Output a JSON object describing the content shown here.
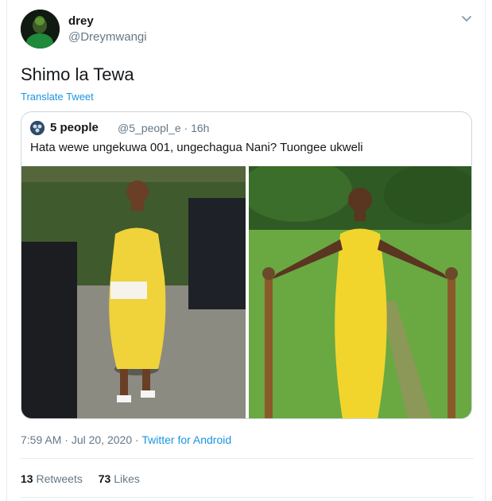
{
  "tweet": {
    "author_name": "drey",
    "author_handle": "@Dreymwangi",
    "text": "Shimo la Tewa",
    "translate_label": "Translate Tweet",
    "time": "7:59 AM",
    "date": "Jul 20, 2020",
    "source": "Twitter for Android",
    "retweets_count": "13",
    "retweets_label": "Retweets",
    "likes_count": "73",
    "likes_label": "Likes"
  },
  "quoted": {
    "author_name": "5 people",
    "author_handle": "@5_peopl_e",
    "age": "16h",
    "text": "Hata wewe ungekuwa 001, ungechagua Nani? Tuongee ukweli"
  },
  "colors": {
    "link": "#1b95e0",
    "muted": "#657786",
    "border": "#e6ecf0"
  },
  "icons": [
    "chevron-down-icon",
    "avatar"
  ]
}
